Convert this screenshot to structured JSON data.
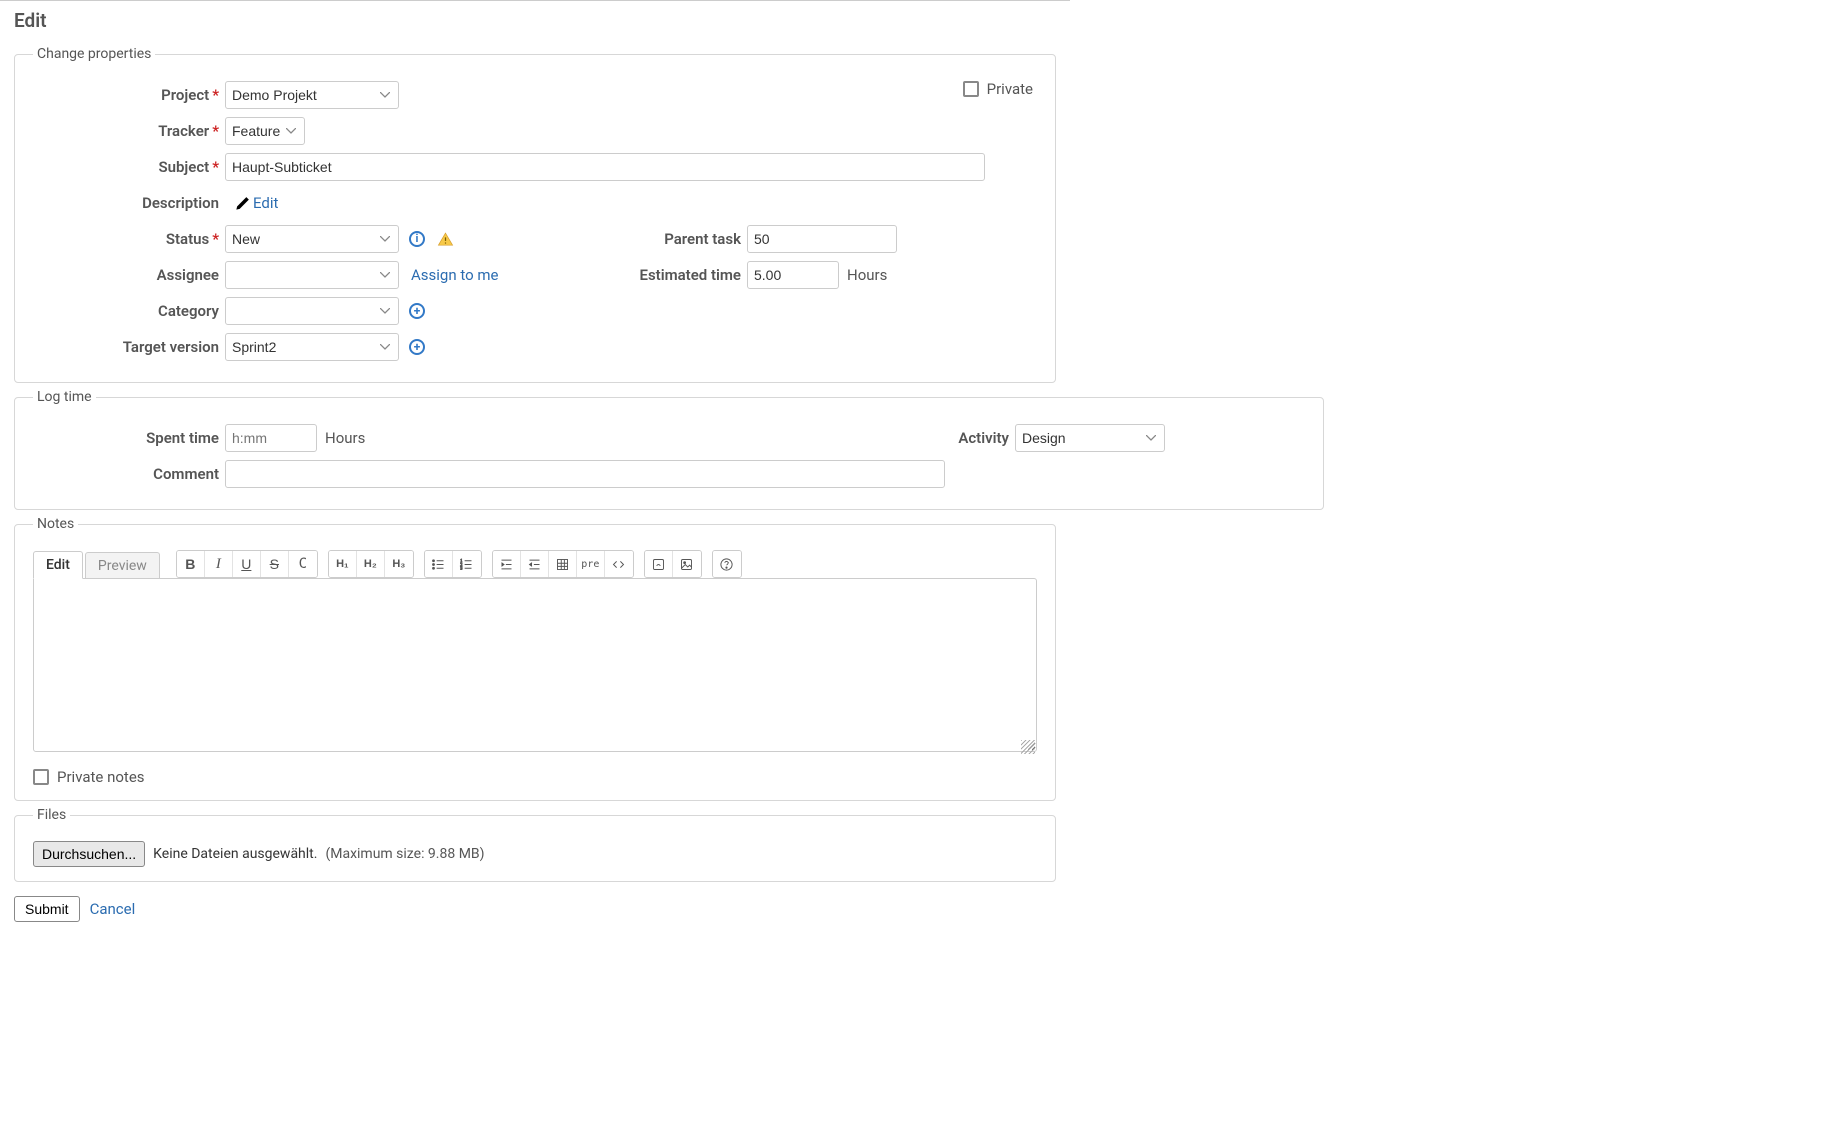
{
  "page_title": "Edit",
  "legends": {
    "change_properties": "Change properties",
    "log_time": "Log time",
    "notes": "Notes",
    "files": "Files"
  },
  "labels": {
    "project": "Project",
    "tracker": "Tracker",
    "subject": "Subject",
    "description": "Description",
    "status": "Status",
    "assignee": "Assignee",
    "category": "Category",
    "target_version": "Target version",
    "parent_task": "Parent task",
    "estimated_time": "Estimated time",
    "spent_time": "Spent time",
    "comment": "Comment",
    "activity": "Activity",
    "private": "Private",
    "private_notes": "Private notes",
    "hours": "Hours"
  },
  "values": {
    "project": "Demo Projekt",
    "tracker": "Feature",
    "subject": "Haupt-Subticket",
    "status": "New",
    "assignee": "",
    "category": "",
    "target_version": "Sprint2",
    "parent_task": "50",
    "estimated_time": "5.00",
    "spent_time_placeholder": "h:mm",
    "activity": "Design",
    "comment": ""
  },
  "links": {
    "edit_description": "Edit",
    "assign_to_me": "Assign to me"
  },
  "notes": {
    "tab_edit": "Edit",
    "tab_preview": "Preview"
  },
  "files": {
    "browse_btn": "Durchsuchen...",
    "no_file": "Keine Dateien ausgewählt.",
    "max_size": "(Maximum size: 9.88 MB)"
  },
  "actions": {
    "submit": "Submit",
    "cancel": "Cancel"
  }
}
